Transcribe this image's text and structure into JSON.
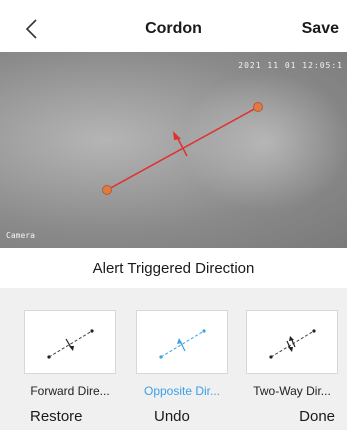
{
  "header": {
    "title": "Cordon",
    "save_label": "Save",
    "back_icon": "chevron-left-icon"
  },
  "camera": {
    "timestamp": "2021 11 01 12:05:1",
    "label": "Camera",
    "line_color": "#e03030",
    "endpoint_color": "#e07a45"
  },
  "section": {
    "title": "Alert Triggered Direction"
  },
  "options": [
    {
      "label": "Forward Dire...",
      "selected": false
    },
    {
      "label": "Opposite Dir...",
      "selected": true
    },
    {
      "label": "Two-Way Dir...",
      "selected": false
    }
  ],
  "actions": {
    "restore": "Restore",
    "undo": "Undo",
    "done": "Done"
  },
  "colors": {
    "accent": "#3aa0e8",
    "panel_bg": "#f0f0f0"
  }
}
